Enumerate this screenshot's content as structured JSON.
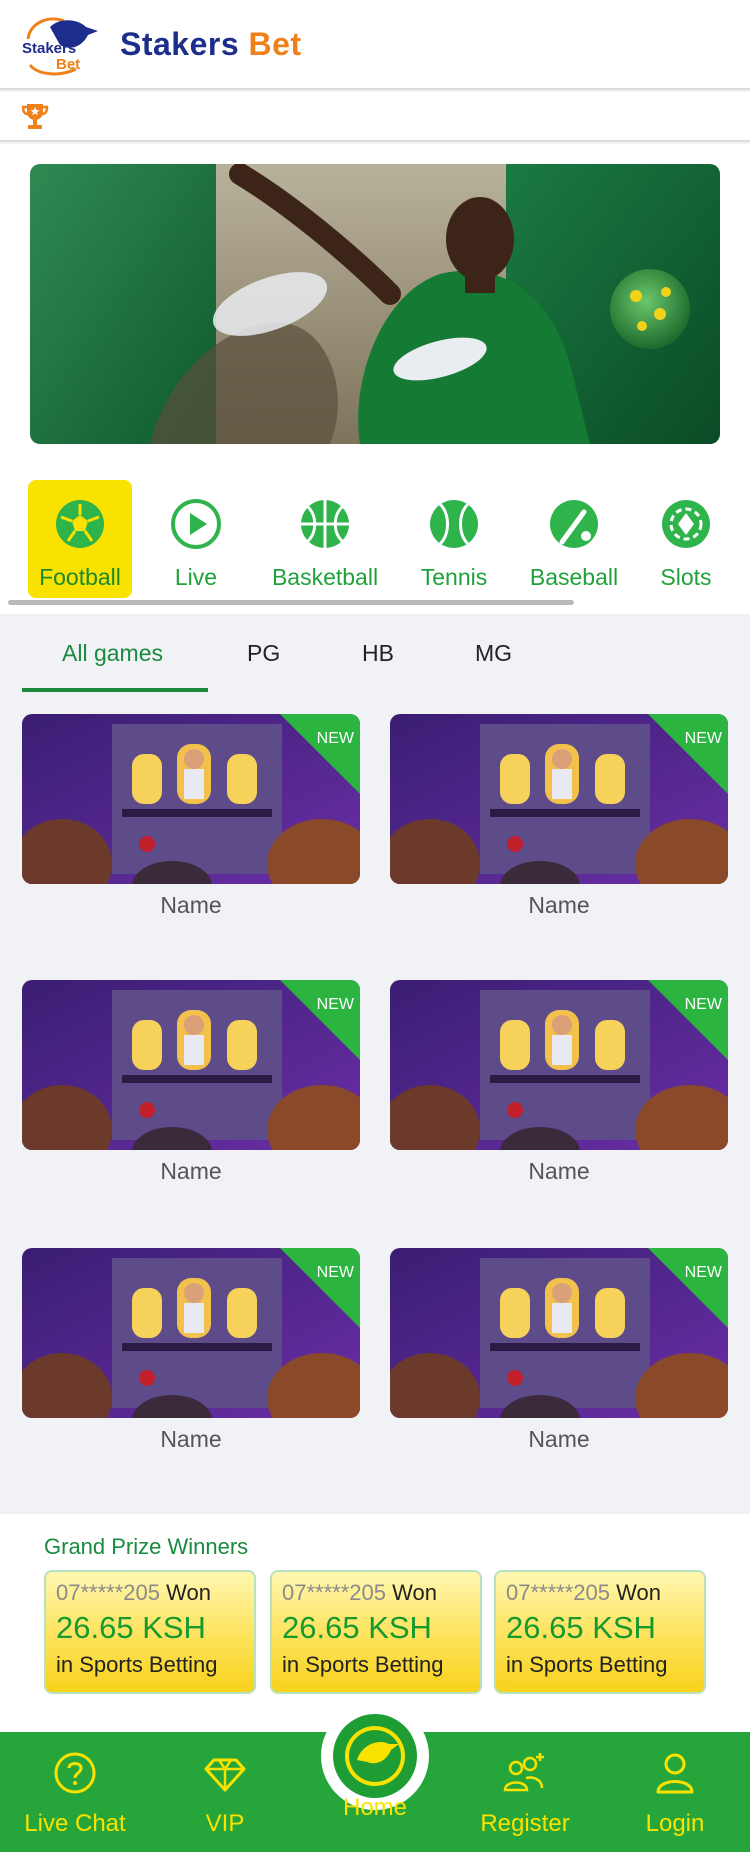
{
  "header": {
    "logo_text_top": "Stakers",
    "logo_text_bottom": "Bet",
    "brand_part1": "Stakers",
    "brand_part2": "Bet"
  },
  "icons": {
    "trophy": "trophy-icon"
  },
  "colors": {
    "brand_green": "#26a63a",
    "accent_yellow": "#f9e200",
    "brand_navy": "#1d2d8c",
    "brand_orange": "#f08019"
  },
  "sports": [
    {
      "label": "Football",
      "icon": "football-icon",
      "active": true
    },
    {
      "label": "Live",
      "icon": "play-icon",
      "active": false
    },
    {
      "label": "Basketball",
      "icon": "basketball-icon",
      "active": false
    },
    {
      "label": "Tennis",
      "icon": "tennis-icon",
      "active": false
    },
    {
      "label": "Baseball",
      "icon": "baseball-icon",
      "active": false
    },
    {
      "label": "Slots",
      "icon": "slots-icon",
      "active": false
    }
  ],
  "game_tabs": [
    {
      "label": "All games",
      "active": true
    },
    {
      "label": "PG",
      "active": false
    },
    {
      "label": "HB",
      "active": false
    },
    {
      "label": "MG",
      "active": false
    }
  ],
  "games": [
    {
      "name": "Name",
      "badge": "NEW"
    },
    {
      "name": "Name",
      "badge": "NEW"
    },
    {
      "name": "Name",
      "badge": "NEW"
    },
    {
      "name": "Name",
      "badge": "NEW"
    },
    {
      "name": "Name",
      "badge": "NEW"
    },
    {
      "name": "Name",
      "badge": "NEW"
    }
  ],
  "winners": {
    "title": "Grand Prize Winners",
    "items": [
      {
        "phone": "07*****205",
        "won": "Won",
        "amount": "26.65 KSH",
        "where": "in Sports Betting"
      },
      {
        "phone": "07*****205",
        "won": "Won",
        "amount": "26.65 KSH",
        "where": "in Sports Betting"
      },
      {
        "phone": "07*****205",
        "won": "Won",
        "amount": "26.65 KSH",
        "where": "in Sports Betting"
      }
    ]
  },
  "nav": [
    {
      "label": "Live Chat",
      "icon": "help-circle-icon"
    },
    {
      "label": "VIP",
      "icon": "diamond-icon"
    },
    {
      "label": "Home",
      "icon": "home-logo-icon"
    },
    {
      "label": "Register",
      "icon": "add-user-icon"
    },
    {
      "label": "Login",
      "icon": "user-icon"
    }
  ]
}
